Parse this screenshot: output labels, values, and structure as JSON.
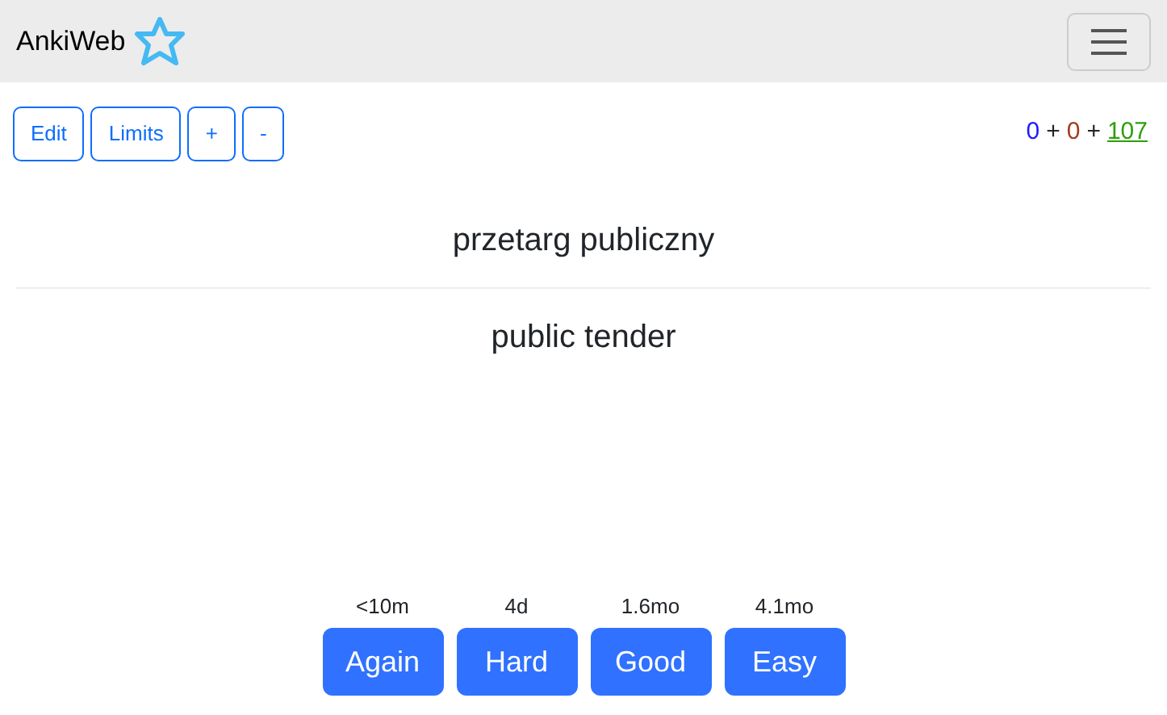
{
  "navbar": {
    "brand": "AnkiWeb"
  },
  "toolbar": [
    {
      "label": "Edit"
    },
    {
      "label": "Limits"
    },
    {
      "label": "+"
    },
    {
      "label": "-"
    }
  ],
  "counts": [
    {
      "kind": "count",
      "text": "0",
      "color": "#1a1aff",
      "selected": false
    },
    {
      "kind": "plus",
      "text": "+"
    },
    {
      "kind": "count",
      "text": "0",
      "color": "#a33b1a",
      "selected": false
    },
    {
      "kind": "plus",
      "text": "+"
    },
    {
      "kind": "count",
      "text": "107",
      "color": "#2e9e0c",
      "selected": true
    }
  ],
  "card": {
    "question": "przetarg publiczny",
    "answer": "public tender"
  },
  "answers": [
    {
      "interval": "<10m",
      "label": "Again"
    },
    {
      "interval": "4d",
      "label": "Hard"
    },
    {
      "interval": "1.6mo",
      "label": "Good"
    },
    {
      "interval": "4.1mo",
      "label": "Easy"
    }
  ]
}
